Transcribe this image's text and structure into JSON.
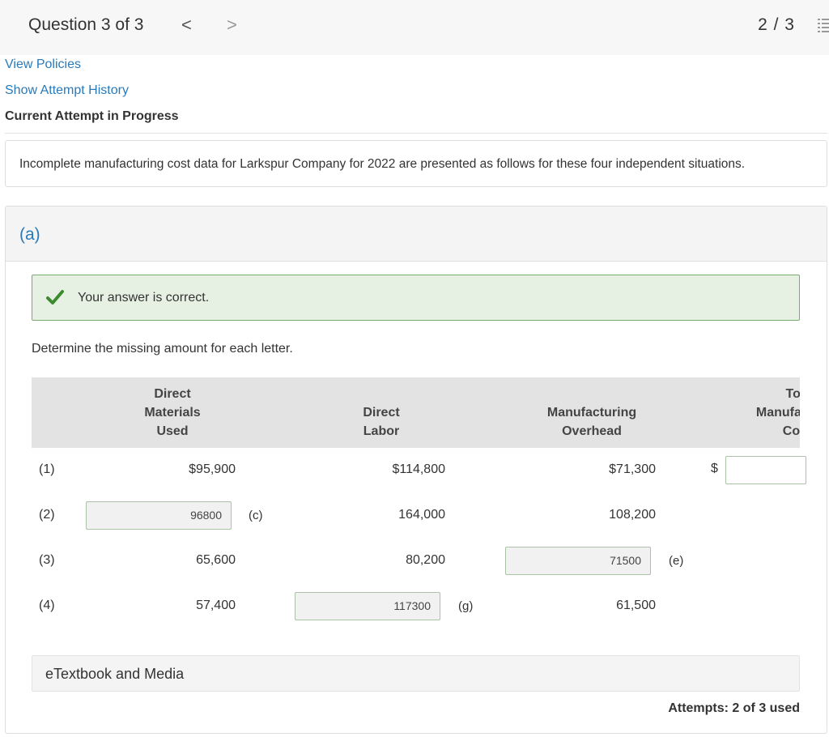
{
  "header": {
    "question_title": "Question 3 of 3",
    "prev_glyph": "<",
    "next_glyph": ">",
    "score": "2 / 3"
  },
  "links": {
    "view_policies": "View Policies",
    "show_attempt_history": "Show Attempt History"
  },
  "current_attempt": "Current Attempt in Progress",
  "intro": "Incomplete manufacturing cost data for Larkspur Company for 2022 are presented as follows for these four independent situations.",
  "part": {
    "label": "(a)",
    "feedback": "Your answer is correct.",
    "instruction": "Determine the missing amount for each letter."
  },
  "table": {
    "headers": {
      "direct_materials": [
        "Direct",
        "Materials",
        "Used"
      ],
      "direct_labor": [
        "Direct",
        "Labor"
      ],
      "manufacturing_overhead": [
        "Manufacturing",
        "Overhead"
      ],
      "total_manufacturing_cost": [
        "Total",
        "Manufacturing",
        "Costs"
      ]
    },
    "rows": [
      {
        "label": "(1)",
        "direct_materials": "$95,900",
        "direct_labor": "$114,800",
        "overhead": "$71,300",
        "total_prefix": "$"
      },
      {
        "label": "(2)",
        "direct_materials_input": "96800",
        "direct_materials_letter": "(c)",
        "direct_labor": "164,000",
        "overhead": "108,200"
      },
      {
        "label": "(3)",
        "direct_materials": "65,600",
        "direct_labor": "80,200",
        "overhead_input": "71500",
        "overhead_letter": "(e)"
      },
      {
        "label": "(4)",
        "direct_materials": "57,400",
        "direct_labor_input": "117300",
        "direct_labor_letter": "(g)",
        "overhead": "61,500"
      }
    ]
  },
  "etextbook": "eTextbook and Media",
  "attempts": "Attempts: 2 of 3 used",
  "colors": {
    "link": "#2a7ab8",
    "success_bg": "#e6f1e3",
    "success_border": "#78ad6f",
    "check": "#3d8b2f"
  }
}
